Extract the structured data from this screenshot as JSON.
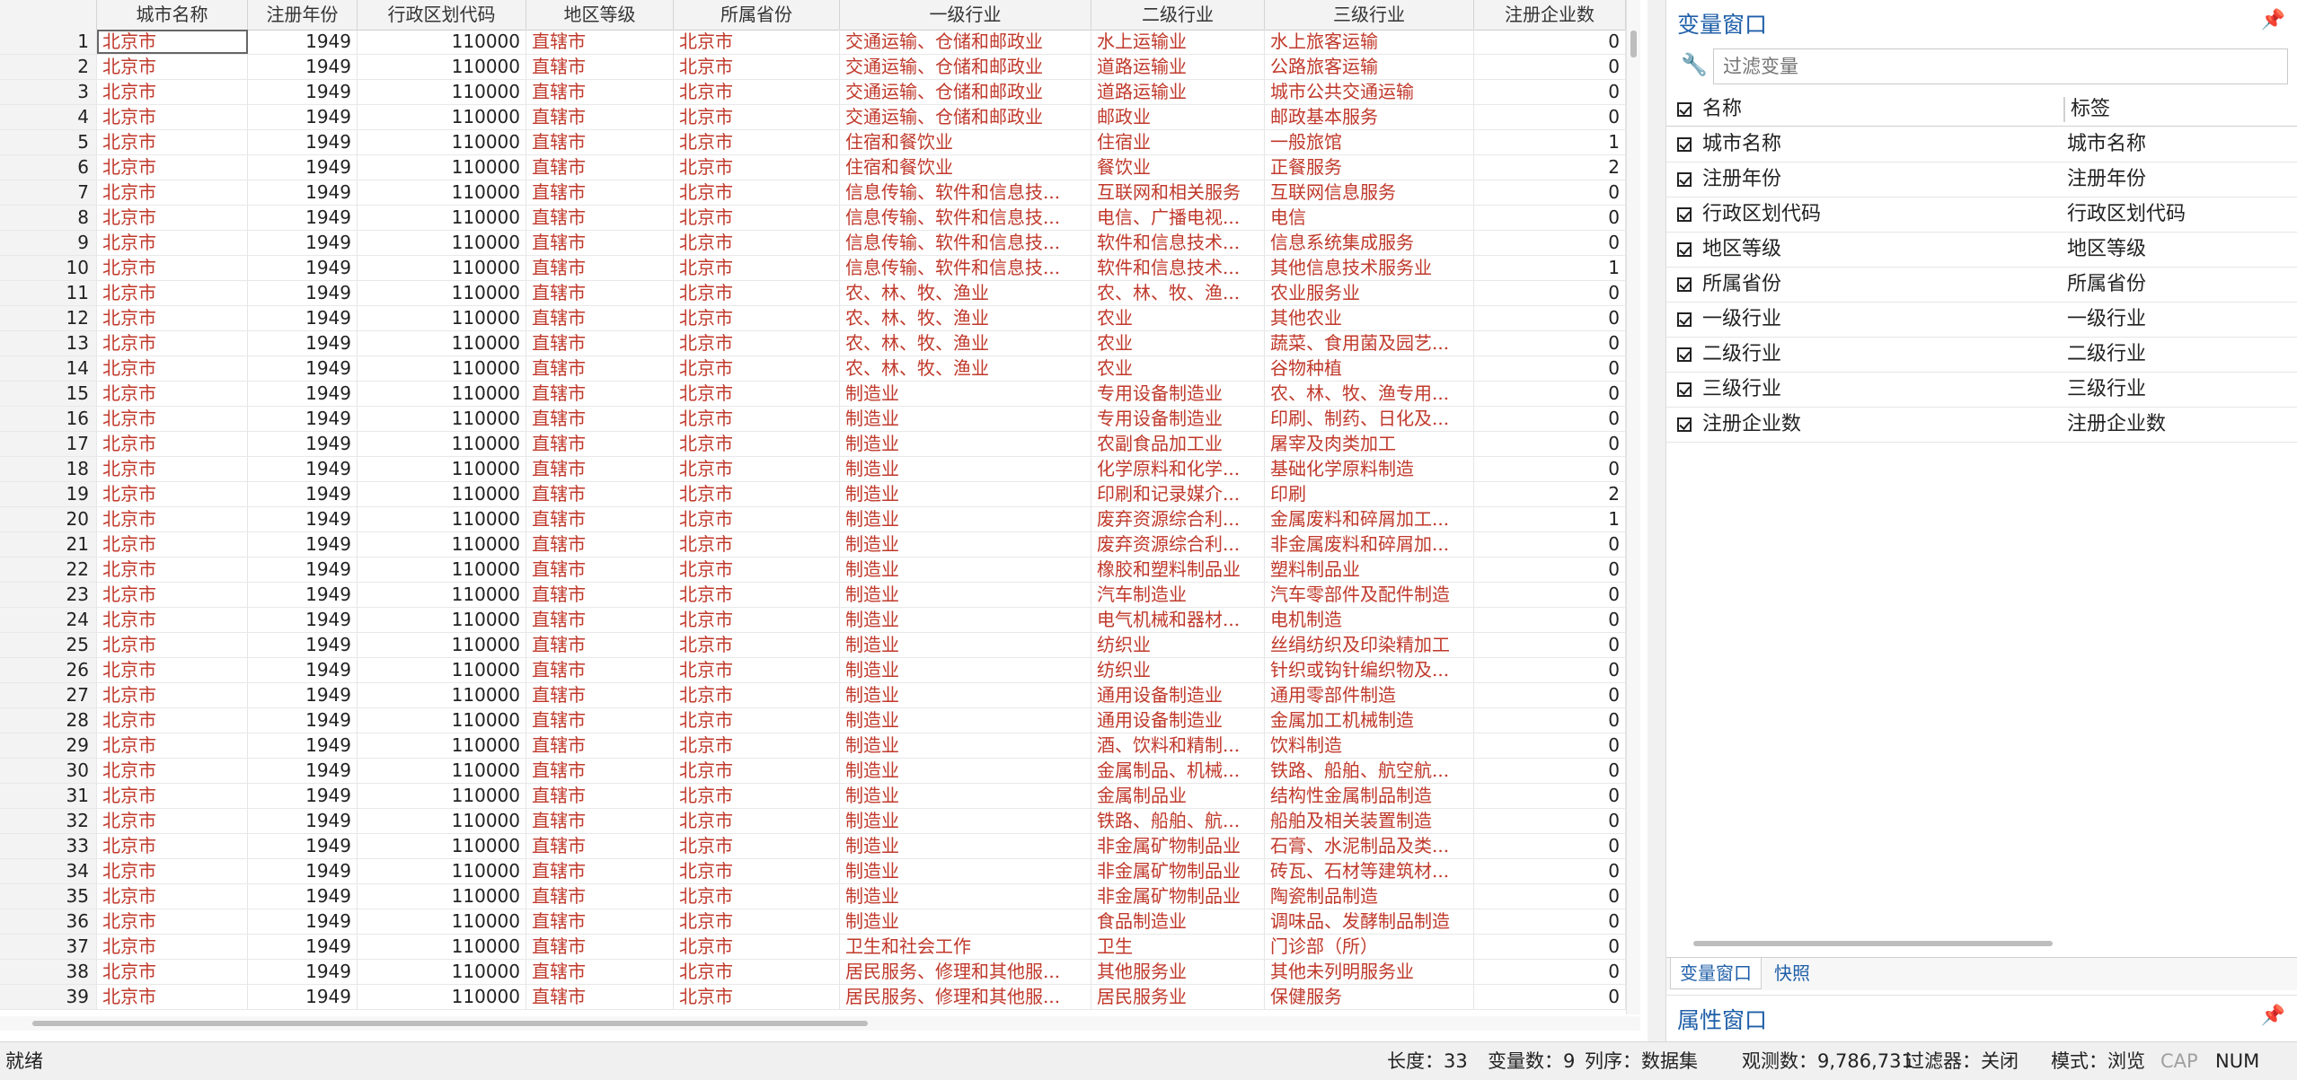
{
  "grid": {
    "columns": [
      "城市名称",
      "注册年份",
      "行政区划代码",
      "地区等级",
      "所属省份",
      "一级行业",
      "二级行业",
      "三级行业",
      "注册企业数"
    ],
    "rows": [
      [
        "1",
        "北京市",
        "1949",
        "110000",
        "直辖市",
        "北京市",
        "交通运输、仓储和邮政业",
        "水上运输业",
        "水上旅客运输",
        "0"
      ],
      [
        "2",
        "北京市",
        "1949",
        "110000",
        "直辖市",
        "北京市",
        "交通运输、仓储和邮政业",
        "道路运输业",
        "公路旅客运输",
        "0"
      ],
      [
        "3",
        "北京市",
        "1949",
        "110000",
        "直辖市",
        "北京市",
        "交通运输、仓储和邮政业",
        "道路运输业",
        "城市公共交通运输",
        "0"
      ],
      [
        "4",
        "北京市",
        "1949",
        "110000",
        "直辖市",
        "北京市",
        "交通运输、仓储和邮政业",
        "邮政业",
        "邮政基本服务",
        "0"
      ],
      [
        "5",
        "北京市",
        "1949",
        "110000",
        "直辖市",
        "北京市",
        "住宿和餐饮业",
        "住宿业",
        "一般旅馆",
        "1"
      ],
      [
        "6",
        "北京市",
        "1949",
        "110000",
        "直辖市",
        "北京市",
        "住宿和餐饮业",
        "餐饮业",
        "正餐服务",
        "2"
      ],
      [
        "7",
        "北京市",
        "1949",
        "110000",
        "直辖市",
        "北京市",
        "信息传输、软件和信息技...",
        "互联网和相关服务",
        "互联网信息服务",
        "0"
      ],
      [
        "8",
        "北京市",
        "1949",
        "110000",
        "直辖市",
        "北京市",
        "信息传输、软件和信息技...",
        "电信、广播电视...",
        "电信",
        "0"
      ],
      [
        "9",
        "北京市",
        "1949",
        "110000",
        "直辖市",
        "北京市",
        "信息传输、软件和信息技...",
        "软件和信息技术...",
        "信息系统集成服务",
        "0"
      ],
      [
        "10",
        "北京市",
        "1949",
        "110000",
        "直辖市",
        "北京市",
        "信息传输、软件和信息技...",
        "软件和信息技术...",
        "其他信息技术服务业",
        "1"
      ],
      [
        "11",
        "北京市",
        "1949",
        "110000",
        "直辖市",
        "北京市",
        "农、林、牧、渔业",
        "农、林、牧、渔...",
        "农业服务业",
        "0"
      ],
      [
        "12",
        "北京市",
        "1949",
        "110000",
        "直辖市",
        "北京市",
        "农、林、牧、渔业",
        "农业",
        "其他农业",
        "0"
      ],
      [
        "13",
        "北京市",
        "1949",
        "110000",
        "直辖市",
        "北京市",
        "农、林、牧、渔业",
        "农业",
        "蔬菜、食用菌及园艺...",
        "0"
      ],
      [
        "14",
        "北京市",
        "1949",
        "110000",
        "直辖市",
        "北京市",
        "农、林、牧、渔业",
        "农业",
        "谷物种植",
        "0"
      ],
      [
        "15",
        "北京市",
        "1949",
        "110000",
        "直辖市",
        "北京市",
        "制造业",
        "专用设备制造业",
        "农、林、牧、渔专用...",
        "0"
      ],
      [
        "16",
        "北京市",
        "1949",
        "110000",
        "直辖市",
        "北京市",
        "制造业",
        "专用设备制造业",
        "印刷、制药、日化及...",
        "0"
      ],
      [
        "17",
        "北京市",
        "1949",
        "110000",
        "直辖市",
        "北京市",
        "制造业",
        "农副食品加工业",
        "屠宰及肉类加工",
        "0"
      ],
      [
        "18",
        "北京市",
        "1949",
        "110000",
        "直辖市",
        "北京市",
        "制造业",
        "化学原料和化学...",
        "基础化学原料制造",
        "0"
      ],
      [
        "19",
        "北京市",
        "1949",
        "110000",
        "直辖市",
        "北京市",
        "制造业",
        "印刷和记录媒介...",
        "印刷",
        "2"
      ],
      [
        "20",
        "北京市",
        "1949",
        "110000",
        "直辖市",
        "北京市",
        "制造业",
        "废弃资源综合利...",
        "金属废料和碎屑加工...",
        "1"
      ],
      [
        "21",
        "北京市",
        "1949",
        "110000",
        "直辖市",
        "北京市",
        "制造业",
        "废弃资源综合利...",
        "非金属废料和碎屑加...",
        "0"
      ],
      [
        "22",
        "北京市",
        "1949",
        "110000",
        "直辖市",
        "北京市",
        "制造业",
        "橡胶和塑料制品业",
        "塑料制品业",
        "0"
      ],
      [
        "23",
        "北京市",
        "1949",
        "110000",
        "直辖市",
        "北京市",
        "制造业",
        "汽车制造业",
        "汽车零部件及配件制造",
        "0"
      ],
      [
        "24",
        "北京市",
        "1949",
        "110000",
        "直辖市",
        "北京市",
        "制造业",
        "电气机械和器材...",
        "电机制造",
        "0"
      ],
      [
        "25",
        "北京市",
        "1949",
        "110000",
        "直辖市",
        "北京市",
        "制造业",
        "纺织业",
        "丝绢纺织及印染精加工",
        "0"
      ],
      [
        "26",
        "北京市",
        "1949",
        "110000",
        "直辖市",
        "北京市",
        "制造业",
        "纺织业",
        "针织或钩针编织物及...",
        "0"
      ],
      [
        "27",
        "北京市",
        "1949",
        "110000",
        "直辖市",
        "北京市",
        "制造业",
        "通用设备制造业",
        "通用零部件制造",
        "0"
      ],
      [
        "28",
        "北京市",
        "1949",
        "110000",
        "直辖市",
        "北京市",
        "制造业",
        "通用设备制造业",
        "金属加工机械制造",
        "0"
      ],
      [
        "29",
        "北京市",
        "1949",
        "110000",
        "直辖市",
        "北京市",
        "制造业",
        "酒、饮料和精制...",
        "饮料制造",
        "0"
      ],
      [
        "30",
        "北京市",
        "1949",
        "110000",
        "直辖市",
        "北京市",
        "制造业",
        "金属制品、机械...",
        "铁路、船舶、航空航...",
        "0"
      ],
      [
        "31",
        "北京市",
        "1949",
        "110000",
        "直辖市",
        "北京市",
        "制造业",
        "金属制品业",
        "结构性金属制品制造",
        "0"
      ],
      [
        "32",
        "北京市",
        "1949",
        "110000",
        "直辖市",
        "北京市",
        "制造业",
        "铁路、船舶、航...",
        "船舶及相关装置制造",
        "0"
      ],
      [
        "33",
        "北京市",
        "1949",
        "110000",
        "直辖市",
        "北京市",
        "制造业",
        "非金属矿物制品业",
        "石膏、水泥制品及类...",
        "0"
      ],
      [
        "34",
        "北京市",
        "1949",
        "110000",
        "直辖市",
        "北京市",
        "制造业",
        "非金属矿物制品业",
        "砖瓦、石材等建筑材...",
        "0"
      ],
      [
        "35",
        "北京市",
        "1949",
        "110000",
        "直辖市",
        "北京市",
        "制造业",
        "非金属矿物制品业",
        "陶瓷制品制造",
        "0"
      ],
      [
        "36",
        "北京市",
        "1949",
        "110000",
        "直辖市",
        "北京市",
        "制造业",
        "食品制造业",
        "调味品、发酵制品制造",
        "0"
      ],
      [
        "37",
        "北京市",
        "1949",
        "110000",
        "直辖市",
        "北京市",
        "卫生和社会工作",
        "卫生",
        "门诊部（所）",
        "0"
      ],
      [
        "38",
        "北京市",
        "1949",
        "110000",
        "直辖市",
        "北京市",
        "居民服务、修理和其他服...",
        "其他服务业",
        "其他未列明服务业",
        "0"
      ],
      [
        "39",
        "北京市",
        "1949",
        "110000",
        "直辖市",
        "北京市",
        "居民服务、修理和其他服...",
        "居民服务业",
        "保健服务",
        "0"
      ]
    ]
  },
  "var_panel": {
    "title": "变量窗口",
    "pin_glyph": "📌",
    "filter_placeholder": "过滤变量",
    "header_name": "名称",
    "header_label": "标签",
    "variables": [
      {
        "name": "城市名称",
        "label": "城市名称"
      },
      {
        "name": "注册年份",
        "label": "注册年份"
      },
      {
        "name": "行政区划代码",
        "label": "行政区划代码"
      },
      {
        "name": "地区等级",
        "label": "地区等级"
      },
      {
        "name": "所属省份",
        "label": "所属省份"
      },
      {
        "name": "一级行业",
        "label": "一级行业"
      },
      {
        "name": "二级行业",
        "label": "二级行业"
      },
      {
        "name": "三级行业",
        "label": "三级行业"
      },
      {
        "name": "注册企业数",
        "label": "注册企业数"
      }
    ],
    "tabs": [
      "变量窗口",
      "快照"
    ]
  },
  "prop_panel": {
    "title": "属性窗口"
  },
  "status": {
    "ready": "就绪",
    "length": "长度：33",
    "var_count": "变量数：9",
    "order": "列序：数据集",
    "obs": "观测数：9,786,731",
    "filter": "过滤器：关闭",
    "mode": "模式：浏览",
    "cap": "CAP",
    "num": "NUM"
  },
  "colors": {
    "text_value": "#c0392b",
    "accent": "#1f5fa8"
  }
}
